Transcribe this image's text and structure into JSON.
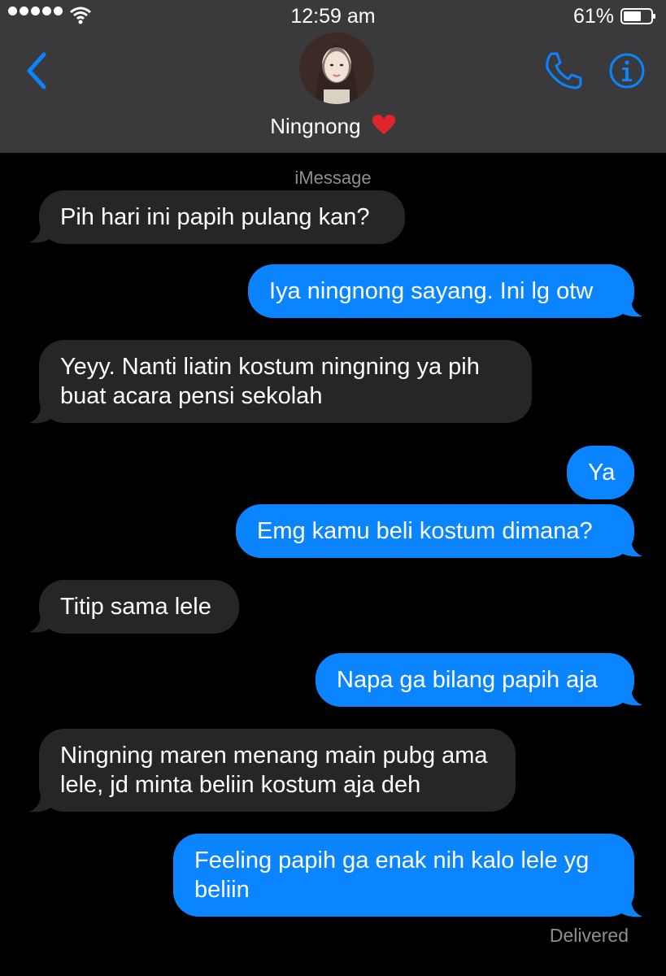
{
  "status_bar": {
    "time": "12:59 am",
    "battery": "61%"
  },
  "header": {
    "contact_name": "Ningnong"
  },
  "thread": {
    "service": "iMessage",
    "messages": [
      {
        "from": "them",
        "text": "Pih hari ini papih pulang kan?"
      },
      {
        "from": "me",
        "text": "Iya ningnong sayang. Ini lg otw"
      },
      {
        "from": "them",
        "text": "Yeyy. Nanti liatin kostum ningning ya pih buat acara pensi sekolah"
      },
      {
        "from": "me",
        "text": "Ya"
      },
      {
        "from": "me",
        "text": "Emg kamu beli kostum dimana?"
      },
      {
        "from": "them",
        "text": "Titip sama lele"
      },
      {
        "from": "me",
        "text": "Napa ga bilang papih aja"
      },
      {
        "from": "them",
        "text": "Ningning maren menang main pubg ama lele, jd minta beliin kostum aja deh"
      },
      {
        "from": "me",
        "text": "Feeling papih ga enak nih kalo lele yg beliin"
      }
    ],
    "delivered_label": "Delivered"
  },
  "colors": {
    "outgoing": "#0a84ff",
    "incoming": "#262628",
    "header_bg": "#3a3a3c",
    "accent": "#0a84ff"
  },
  "icons": [
    "signal-dots-icon",
    "wifi-icon",
    "battery-icon",
    "back-chevron-icon",
    "phone-icon",
    "info-icon",
    "heart-icon"
  ]
}
